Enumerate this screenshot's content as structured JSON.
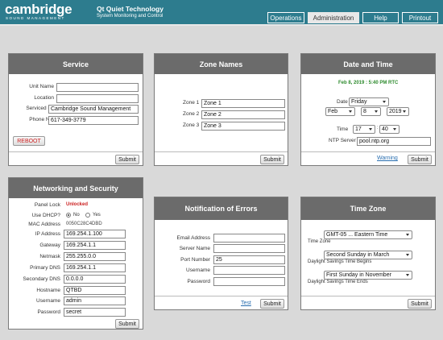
{
  "header": {
    "brand": "cambridge",
    "brand_sub": "SOUND MANAGEMENT",
    "product": "Qt Quiet Technology",
    "product_tag": "System Monitoring and Control",
    "nav": [
      "Operations",
      "Administration",
      "Help",
      "Printout"
    ],
    "active_nav": "Administration",
    "colors": {
      "header_bg": "#2d7c8e",
      "panel_head": "#6b6b6b",
      "reboot": "#cc2222",
      "date_green": "#2e8b2e",
      "unlocked": "#cc2222"
    }
  },
  "service": {
    "title": "Service",
    "labels": [
      "Unit Name",
      "Location",
      "Serviced By",
      "Phone No."
    ],
    "values": [
      "",
      "",
      "Cambridge Sound Management",
      "617-349-3779"
    ],
    "reboot": "REBOOT",
    "submit": "Submit"
  },
  "zones": {
    "title": "Zone Names",
    "labels": [
      "Zone 1",
      "Zone 2",
      "Zone 3"
    ],
    "values": [
      "Zone 1",
      "Zone 2",
      "Zone 3"
    ],
    "submit": "Submit"
  },
  "datetime": {
    "title": "Date and Time",
    "current": "Feb 8, 2019 : 5:40 PM RTC",
    "date_label": "Date",
    "day": "Friday",
    "month": "Feb",
    "daynum": "8",
    "year": "2019",
    "time_label": "Time",
    "hour": "17",
    "minute": "40",
    "ntp_label": "NTP Server",
    "ntp_value": "pool.ntp.org",
    "warning": "Warning",
    "submit": "Submit"
  },
  "network": {
    "title": "Networking and Security",
    "panel_lock_label": "Panel Lock",
    "panel_lock_value": "Unlocked",
    "dhcp_label": "Use DHCP?",
    "dhcp_no": "No",
    "dhcp_yes": "Yes",
    "mac_label": "MAC Address",
    "mac_value": "0050C28C4DBD",
    "labels": [
      "IP Address",
      "Gateway",
      "Netmask",
      "Primary DNS",
      "Secondary DNS",
      "Hostname",
      "Username",
      "Password"
    ],
    "values": [
      "169.254.1.100",
      "169.254.1.1",
      "255.255.0.0",
      "169.254.1.1",
      "0.0.0.0",
      "QTBD",
      "admin",
      "secret"
    ],
    "submit": "Submit"
  },
  "errors": {
    "title": "Notification of Errors",
    "labels": [
      "Email Address",
      "Server Name",
      "Port Number",
      "Username",
      "Password"
    ],
    "values": [
      "",
      "",
      "25",
      "",
      ""
    ],
    "test": "Test",
    "submit": "Submit"
  },
  "timezone": {
    "title": "Time Zone",
    "zone": "GMT-05 ... Eastern Time",
    "zone_caption": "Time Zone",
    "dst_begin": "Second Sunday in March",
    "dst_begin_caption": "Daylight Savings Time Begins",
    "dst_end": "First Sunday in November",
    "dst_end_caption": "Daylight Savings Time Ends",
    "submit": "Submit"
  }
}
